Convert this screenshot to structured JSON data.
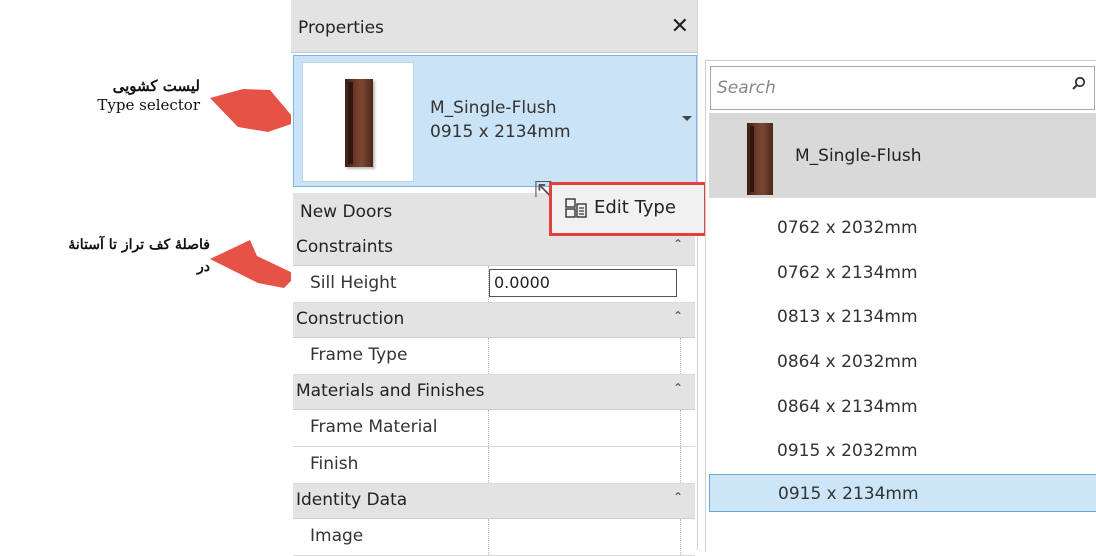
{
  "annotations": {
    "type_selector_fa": "لیست کشویی",
    "type_selector_en": "Type selector",
    "sill_line1": "فاصلهٔ کف تراز تا آستانهٔ",
    "sill_line2": "در"
  },
  "properties": {
    "title": "Properties",
    "close_glyph": "✕",
    "type_selector": {
      "family": "M_Single-Flush",
      "type": "0915 x 2134mm"
    },
    "instance_label": "New Doors",
    "edit_type_label": "Edit Type",
    "sections": [
      {
        "label": "Constraints",
        "params": [
          {
            "label": "Sill Height",
            "value": "0.0000"
          }
        ]
      },
      {
        "label": "Construction",
        "params": [
          {
            "label": "Frame Type",
            "value": ""
          }
        ]
      },
      {
        "label": "Materials and Finishes",
        "params": [
          {
            "label": "Frame Material",
            "value": ""
          },
          {
            "label": "Finish",
            "value": ""
          }
        ]
      },
      {
        "label": "Identity Data",
        "params": [
          {
            "label": "Image",
            "value": ""
          }
        ]
      }
    ]
  },
  "type_list": {
    "search_placeholder": "Search",
    "family": "M_Single-Flush",
    "items": [
      "0762 x 2032mm",
      "0762 x 2134mm",
      "0813 x 2134mm",
      "0864 x 2032mm",
      "0864 x 2134mm",
      "0915 x 2032mm",
      "0915 x 2134mm"
    ],
    "selected": "0915 x 2134mm"
  },
  "colors": {
    "highlight_red": "#e0413a",
    "selection_blue": "#cbe3f6"
  }
}
